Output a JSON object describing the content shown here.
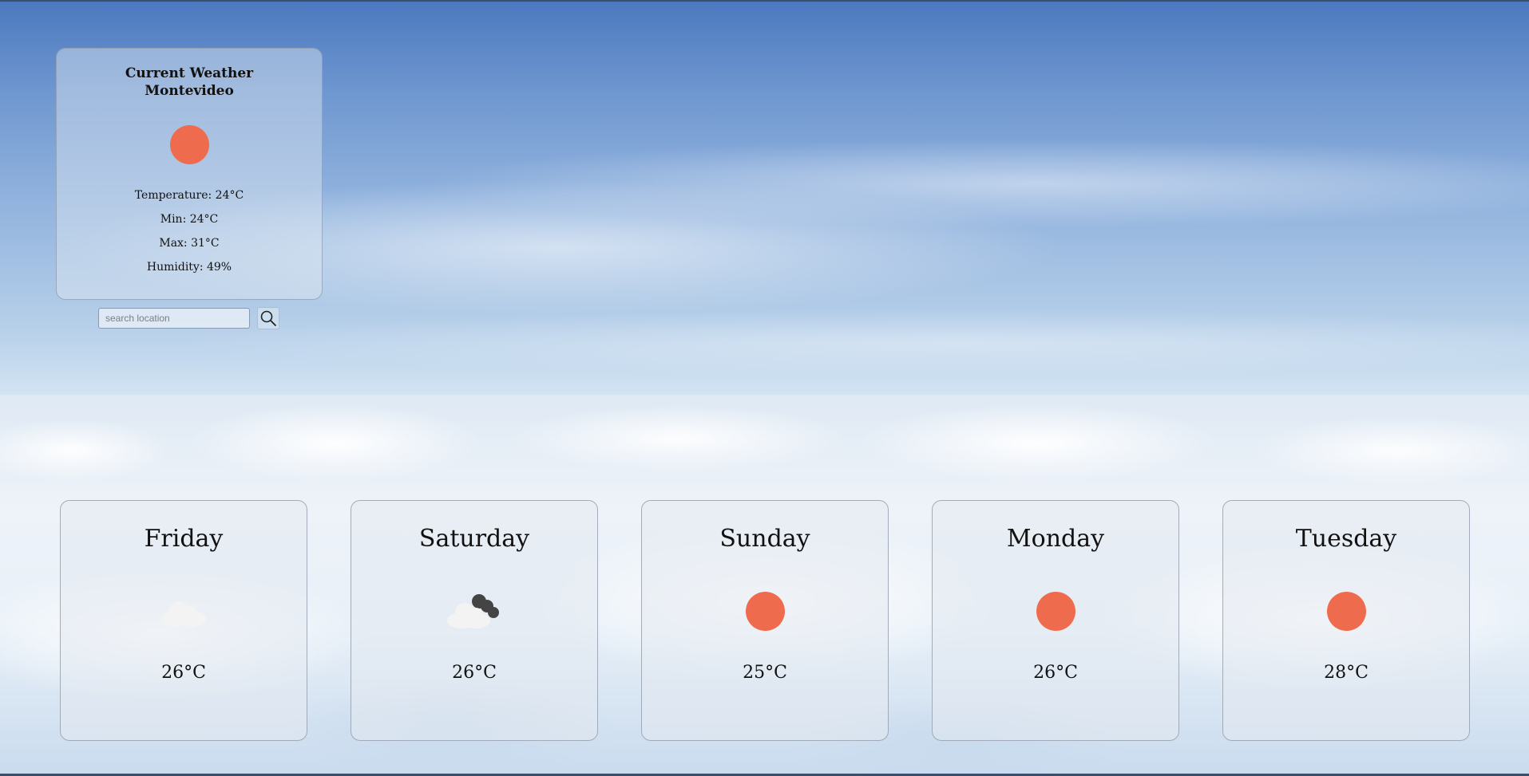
{
  "current": {
    "title": "Current Weather",
    "city": "Montevideo",
    "icon": "sun-icon",
    "temperature": "Temperature: 24°C",
    "min": "Min: 24°C",
    "max": "Max: 31°C",
    "humidity": "Humidity: 49%"
  },
  "search": {
    "placeholder": "search location",
    "value": "",
    "button_icon": "search-icon"
  },
  "forecast": [
    {
      "day": "Friday",
      "icon": "cloud-icon",
      "temp": "26°C"
    },
    {
      "day": "Saturday",
      "icon": "cloud-with-dark-clouds-icon",
      "temp": "26°C"
    },
    {
      "day": "Sunday",
      "icon": "sun-icon",
      "temp": "25°C"
    },
    {
      "day": "Monday",
      "icon": "sun-icon",
      "temp": "26°C"
    },
    {
      "day": "Tuesday",
      "icon": "sun-icon",
      "temp": "28°C"
    }
  ],
  "colors": {
    "sun": "#ee6b4d",
    "light_cloud": "#f2f2f2",
    "dark_cloud": "#444444"
  }
}
